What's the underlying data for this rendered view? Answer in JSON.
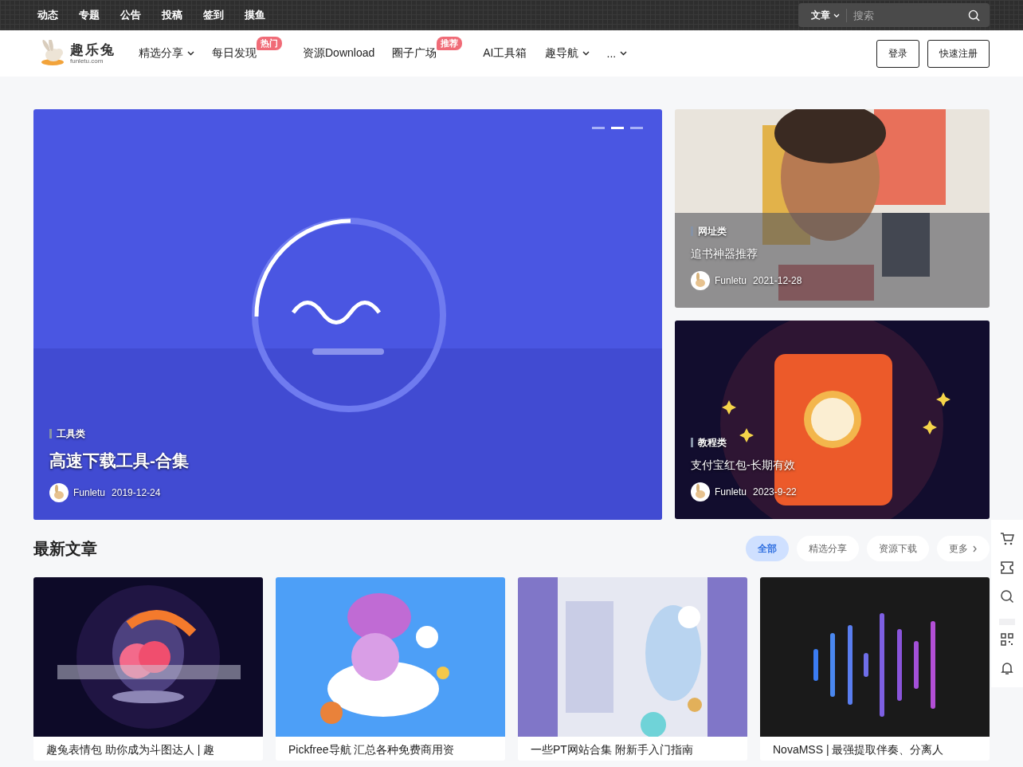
{
  "top_bar": {
    "links": [
      "动态",
      "专题",
      "公告",
      "投稿",
      "签到",
      "摸鱼"
    ],
    "search": {
      "scope": "文章",
      "placeholder": "搜索"
    }
  },
  "header": {
    "logo": {
      "name": "趣乐兔",
      "domain": "funletu.com"
    },
    "menu": [
      {
        "label": "精选分享",
        "dropdown": true
      },
      {
        "label": "每日发现",
        "dropdown": false,
        "badge": "热门"
      },
      {
        "label": "资源Download",
        "dropdown": false
      },
      {
        "label": "圈子广场",
        "dropdown": false,
        "badge": "推荐"
      },
      {
        "label": "AI工具箱",
        "dropdown": false
      },
      {
        "label": "趣导航",
        "dropdown": true
      },
      {
        "label": "...",
        "dropdown": true
      }
    ],
    "buttons": [
      "登录",
      "快速注册"
    ]
  },
  "slider": {
    "dots": [
      {
        "selected": false
      },
      {
        "selected": true
      },
      {
        "selected": false
      }
    ]
  },
  "featured": [
    {
      "kind": "main",
      "category": "工具类",
      "title": "高速下载工具-合集",
      "author": "Funletu",
      "date": "2019-12-24"
    },
    {
      "kind": "side",
      "category": "网址类",
      "title": "追书神器推荐",
      "author": "Funletu",
      "date": "2021-12-28"
    },
    {
      "kind": "side",
      "category": "教程类",
      "title": "支付宝红包-长期有效",
      "author": "Funletu",
      "date": "2023-9-22"
    }
  ],
  "latest": {
    "title": "最新文章",
    "filters": [
      {
        "label": "全部",
        "selected": true
      },
      {
        "label": "精选分享",
        "selected": false
      },
      {
        "label": "资源下载",
        "selected": false
      }
    ],
    "more": "更多",
    "cards": [
      {
        "title": "趣兔表情包 助你成为斗图达人 | 趣"
      },
      {
        "title": "Pickfree导航 汇总各种免费商用资"
      },
      {
        "title": "一些PT网站合集 附新手入门指南"
      },
      {
        "title": "NovaMSS | 最强提取伴奏、分离人"
      }
    ]
  }
}
